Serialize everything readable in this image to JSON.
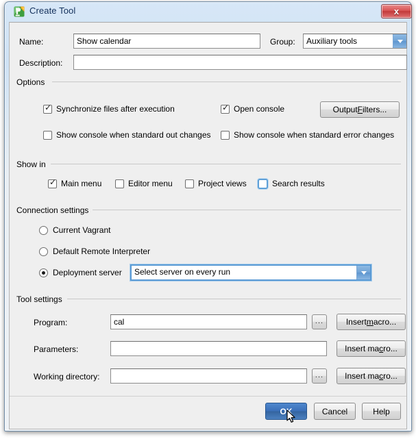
{
  "window": {
    "title": "Create Tool",
    "app_icon": "pycharm-logo-icon",
    "close_label": "x"
  },
  "form": {
    "name_label": "Name:",
    "name_value": "Show calendar",
    "group_label": "Group:",
    "group_value": "Auxiliary tools",
    "description_label": "Description:",
    "description_value": ""
  },
  "options": {
    "legend": "Options",
    "checkboxes": [
      {
        "label": "Synchronize files after execution",
        "checked": true,
        "focused": false
      },
      {
        "label": "Open console",
        "checked": true,
        "focused": false
      },
      {
        "label": "Show console when standard out changes",
        "checked": false,
        "focused": false
      },
      {
        "label": "Show console when standard error changes",
        "checked": false,
        "focused": false
      }
    ],
    "output_filters_button": {
      "pre": "Output ",
      "mnemonic": "F",
      "post": "ilters..."
    }
  },
  "show_in": {
    "legend": "Show in",
    "checkboxes": [
      {
        "label": "Main menu",
        "checked": true,
        "focused": false
      },
      {
        "label": "Editor menu",
        "checked": false,
        "focused": false
      },
      {
        "label": "Project views",
        "checked": false,
        "focused": false
      },
      {
        "label": "Search results",
        "checked": false,
        "focused": true
      }
    ]
  },
  "connection_settings": {
    "legend": "Connection settings",
    "radios": [
      {
        "label": "Current Vagrant",
        "selected": false
      },
      {
        "label": "Default Remote Interpreter",
        "selected": false
      },
      {
        "label": "Deployment server",
        "selected": true
      }
    ],
    "server_combo_value": "Select server on every run",
    "server_combo_focused": true
  },
  "tool_settings": {
    "legend": "Tool settings",
    "rows": [
      {
        "label": "Program:",
        "value": "cal",
        "browse_label": "...",
        "has_browse": true,
        "macro_pre": "Insert ",
        "macro_mnemonic": "m",
        "macro_post": "acro..."
      },
      {
        "label": "Parameters:",
        "value": "",
        "browse_label": "...",
        "has_browse": false,
        "macro_pre": "Insert ma",
        "macro_mnemonic": "c",
        "macro_post": "ro..."
      },
      {
        "label": "Working directory:",
        "value": "",
        "browse_label": "...",
        "has_browse": true,
        "macro_pre": "Insert ma",
        "macro_mnemonic": "c",
        "macro_post": "ro..."
      }
    ]
  },
  "footer": {
    "ok_label": "OK",
    "cancel_label": "Cancel",
    "help_label": "Help"
  },
  "colors": {
    "default_button_blue": "#3a6fb8",
    "focus_blue": "#5b9bd5",
    "dialog_bg": "#efefef",
    "close_red": "#c23a3a"
  }
}
